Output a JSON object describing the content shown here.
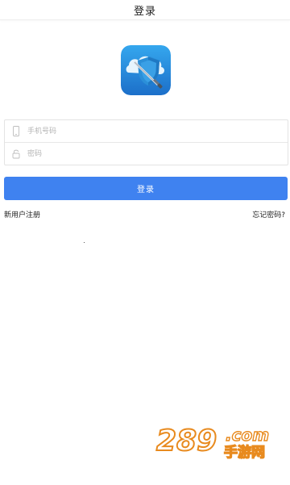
{
  "header": {
    "title": "登录"
  },
  "form": {
    "phone_placeholder": "手机号码",
    "password_placeholder": "密码"
  },
  "login_button_label": "登录",
  "links": {
    "register": "新用户注册",
    "forgot_password": "忘记密码?"
  },
  "watermark": {
    "number": "289",
    "domain": ".com",
    "site_name": "手游网"
  },
  "colors": {
    "primary": "#3f82f0",
    "logo_bg": "#2f8ee0",
    "watermark": "#e88a1e"
  },
  "icons": {
    "phone_field": "phone-icon",
    "password_field": "lock-icon"
  }
}
